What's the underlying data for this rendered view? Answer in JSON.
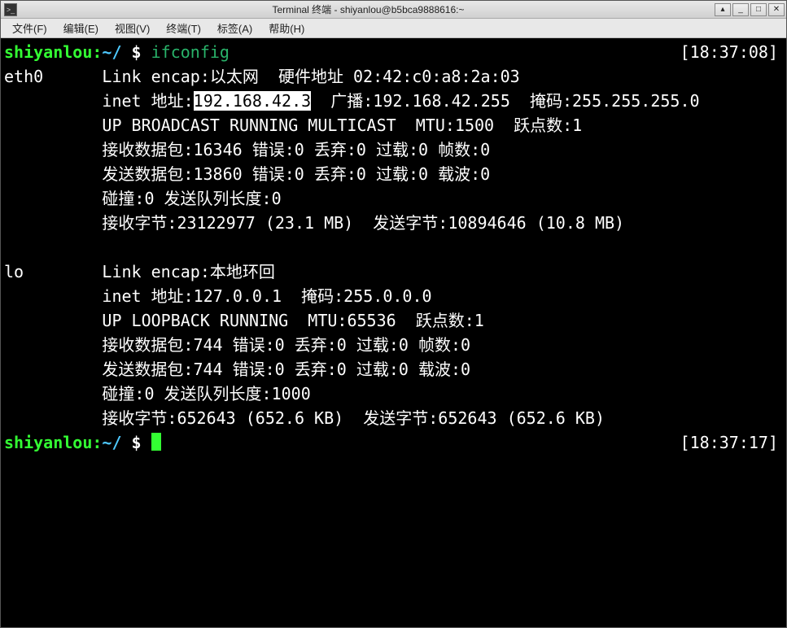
{
  "titlebar": {
    "icon_glyph": ">_",
    "title": "Terminal 终端 - shiyanlou@b5bca9888616:~",
    "btn_rollup": "▴",
    "btn_min": "_",
    "btn_max": "□",
    "btn_close": "✕"
  },
  "menubar": {
    "file": "文件(F)",
    "edit": "编辑(E)",
    "view": "视图(V)",
    "terminal": "终端(T)",
    "tabs": "标签(A)",
    "help": "帮助(H)"
  },
  "prompt": {
    "user": "shiyanlou",
    "colon": ":",
    "path": "~/",
    "dollar": " $ "
  },
  "cmd1": {
    "command": "ifconfig",
    "time": "[18:37:08]"
  },
  "eth0": {
    "iface": "eth0",
    "l1a": "Link encap:以太网  硬件地址 02:42:c0:a8:2a:03",
    "l2_pre": "inet 地址:",
    "l2_hl": "192.168.42.3",
    "l2_post": "  广播:192.168.42.255  掩码:255.255.255.0",
    "l3": "UP BROADCAST RUNNING MULTICAST  MTU:1500  跃点数:1",
    "l4": "接收数据包:16346 错误:0 丢弃:0 过载:0 帧数:0",
    "l5": "发送数据包:13860 错误:0 丢弃:0 过载:0 载波:0",
    "l6": "碰撞:0 发送队列长度:0",
    "l7": "接收字节:23122977 (23.1 MB)  发送字节:10894646 (10.8 MB)"
  },
  "lo": {
    "iface": "lo",
    "l1": "Link encap:本地环回",
    "l2": "inet 地址:127.0.0.1  掩码:255.0.0.0",
    "l3": "UP LOOPBACK RUNNING  MTU:65536  跃点数:1",
    "l4": "接收数据包:744 错误:0 丢弃:0 过载:0 帧数:0",
    "l5": "发送数据包:744 错误:0 丢弃:0 过载:0 载波:0",
    "l6": "碰撞:0 发送队列长度:1000",
    "l7": "接收字节:652643 (652.6 KB)  发送字节:652643 (652.6 KB)"
  },
  "cmd2": {
    "time": "[18:37:17]"
  },
  "indent10": "          "
}
